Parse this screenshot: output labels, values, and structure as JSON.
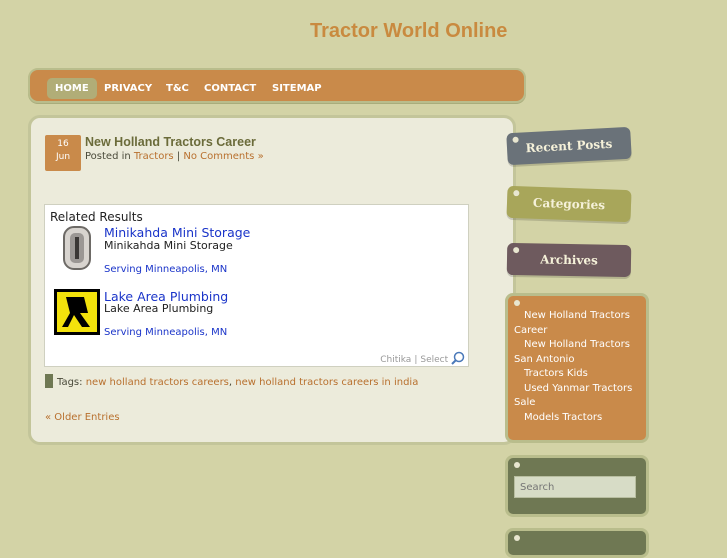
{
  "site": {
    "title": "Tractor World Online"
  },
  "nav": {
    "items": [
      "HOME",
      "PRIVACY",
      "T&C",
      "CONTACT",
      "SITEMAP"
    ]
  },
  "post": {
    "day": "16",
    "month": "Jun",
    "title": "New Holland Tractors Career",
    "posted_in_label": "Posted in",
    "category": "Tractors",
    "separator": "|",
    "comments": "No Comments »",
    "tags_label": "Tags:",
    "tags": [
      "new holland tractors careers",
      "new holland tractors careers in india"
    ],
    "tag_separator": ","
  },
  "related": {
    "heading": "Related Results",
    "items": [
      {
        "title": "Minikahda Mini Storage",
        "desc": "Minikahda Mini Storage",
        "location": "Serving Minneapolis, MN",
        "icon": "storage-door-icon"
      },
      {
        "title": "Lake Area Plumbing",
        "desc": "Lake Area Plumbing",
        "location": "Serving Minneapolis, MN",
        "icon": "yellow-pages-walking-fingers-icon"
      }
    ],
    "footer": {
      "brand": "Chitika",
      "sep": "|",
      "select": "Select"
    }
  },
  "pagination": {
    "older": "« Older Entries"
  },
  "sidebar": {
    "tabs": [
      "Recent Posts",
      "Categories",
      "Archives"
    ],
    "links": [
      "New Holland Tractors Career",
      "New Holland Tractors San Antonio",
      "Tractors Kids",
      "Used Yanmar Tractors Sale",
      "Models Tractors"
    ],
    "search_placeholder": "Search"
  },
  "colors": {
    "accent": "#c98a4a",
    "background": "#d3d3a6",
    "link": "#b8702e",
    "ad_link": "#1a34c9"
  }
}
